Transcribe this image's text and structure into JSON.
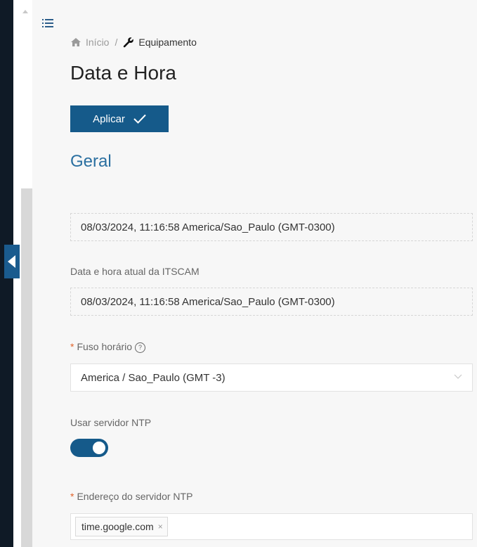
{
  "breadcrumb": {
    "home_label": "Início",
    "separator": "/",
    "current_label": "Equipamento"
  },
  "page": {
    "title": "Data e Hora"
  },
  "toolbar": {
    "apply_label": "Aplicar"
  },
  "section": {
    "title": "Geral"
  },
  "fields": {
    "browser_datetime": "08/03/2024, 11:16:58 America/Sao_Paulo (GMT-0300)",
    "device_datetime_label": "Data e hora atual da ITSCAM",
    "device_datetime": "08/03/2024, 11:16:58 America/Sao_Paulo (GMT-0300)",
    "required_mark": "*",
    "timezone_label": "Fuso horário",
    "timezone_help": "?",
    "timezone_value": "America / Sao_Paulo (GMT -3)",
    "ntp_toggle_label": "Usar servidor NTP",
    "ntp_enabled": true,
    "ntp_address_label": "Endereço do servidor NTP",
    "ntp_servers": [
      "time.google.com"
    ],
    "tag_remove": "×"
  },
  "colors": {
    "primary": "#155a8a",
    "section_title": "#2a6fa0",
    "required": "#e0632b",
    "sidebar_dark": "#0f1a26"
  },
  "icons": [
    "menu-icon",
    "home-icon",
    "wrench-icon",
    "check-icon",
    "help-icon",
    "chevron-down-icon",
    "collapse-arrow-icon",
    "close-icon"
  ]
}
